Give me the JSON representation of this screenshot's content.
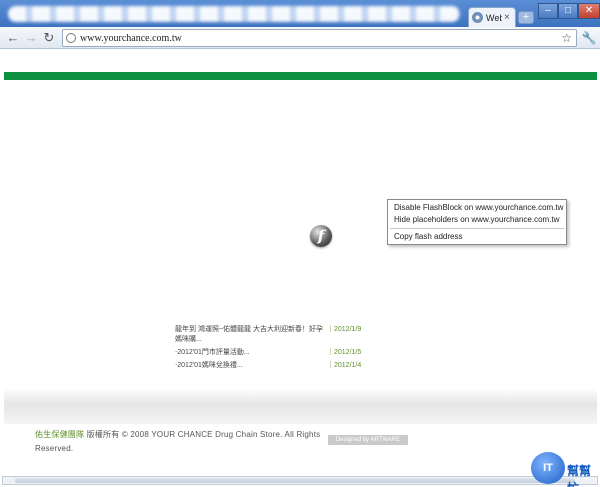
{
  "browser": {
    "tab_title": "Web",
    "tab_close": "×",
    "new_tab": "+",
    "window_buttons": [
      "–",
      "□",
      "✕"
    ],
    "back": "←",
    "forward": "→",
    "reload": "↻",
    "url": "www.yourchance.com.tw",
    "star": "☆",
    "wrench": "🔧"
  },
  "flash": {
    "glyph": "f"
  },
  "context_menu": {
    "items": [
      "Disable FlashBlock on www.yourchance.com.tw",
      "Hide placeholders on www.yourchance.com.tw",
      "Copy flash address"
    ]
  },
  "news": [
    {
      "title": "龍年到 鴻運照~佑體龍龍 大吉大利迎新春！好孕媽咪購...",
      "date": "｜2012/1/9"
    },
    {
      "title": "‧2012'01門市評量活動...",
      "date": "｜2012/1/5"
    },
    {
      "title": "‧2012'01媽咪兌換禮...",
      "date": "｜2012/1/4"
    }
  ],
  "footer": {
    "link": "佑生保健團隊",
    "text": " 版權所有 © 2008 YOUR CHANCE Drug Chain Store. All Rights Reserved.",
    "designed_by": "Designed by ARTWARE"
  },
  "watermark": {
    "logo": "IT",
    "text": "幫幫忙"
  },
  "colors": {
    "brand_green": "#0c9140",
    "link_green": "#5f8f2a"
  }
}
